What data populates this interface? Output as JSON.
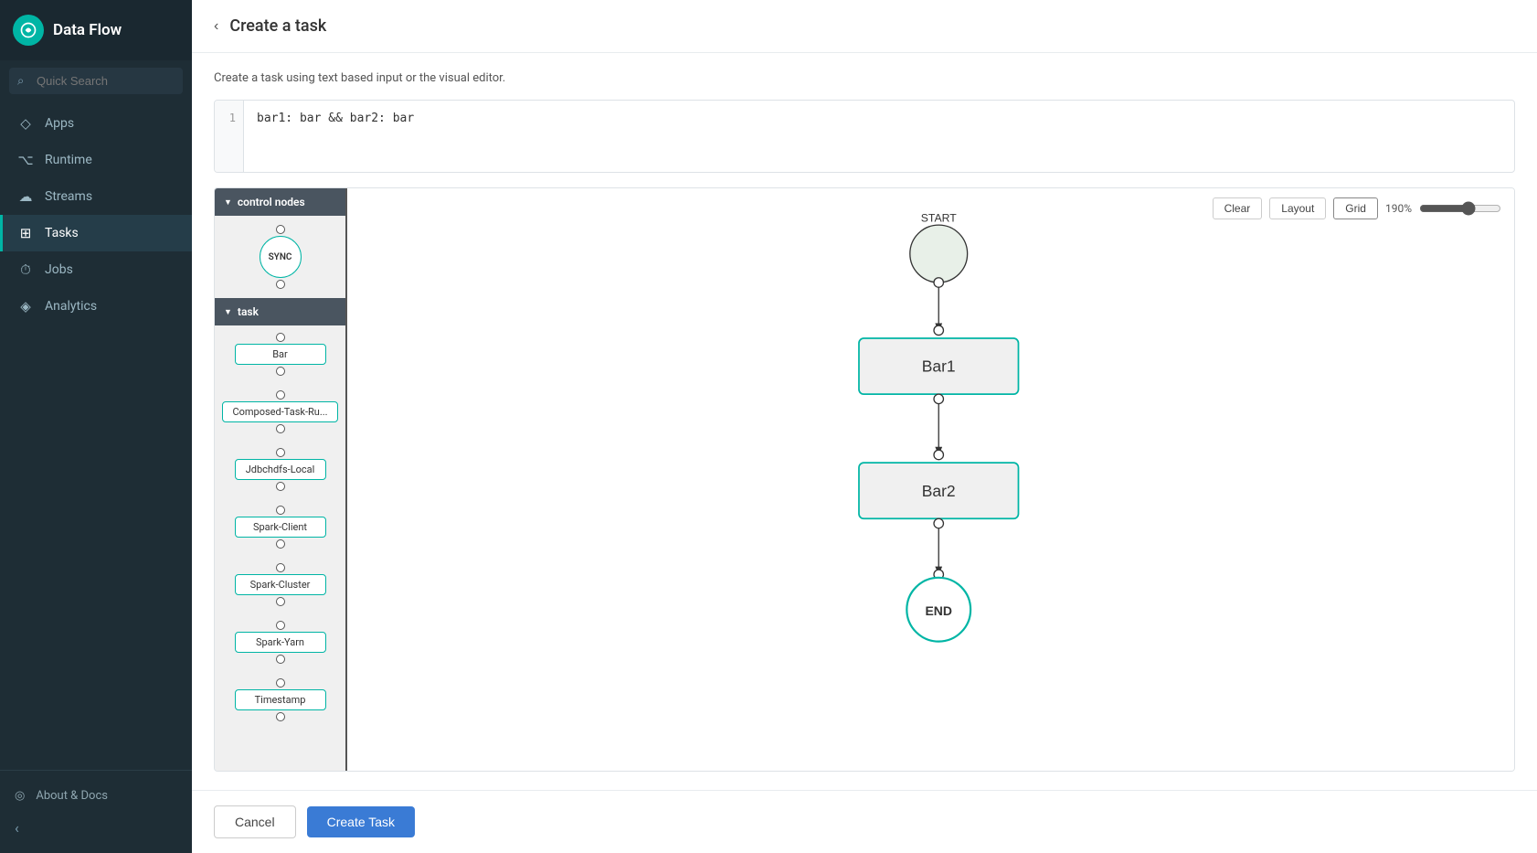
{
  "sidebar": {
    "title": "Data Flow",
    "search_placeholder": "Quick Search",
    "nav_items": [
      {
        "id": "apps",
        "label": "Apps",
        "icon": "◈"
      },
      {
        "id": "runtime",
        "label": "Runtime",
        "icon": "⌥"
      },
      {
        "id": "streams",
        "label": "Streams",
        "icon": "☁"
      },
      {
        "id": "tasks",
        "label": "Tasks",
        "icon": "⊞",
        "active": true
      },
      {
        "id": "jobs",
        "label": "Jobs",
        "icon": "⏱"
      },
      {
        "id": "analytics",
        "label": "Analytics",
        "icon": "◈"
      }
    ],
    "footer_item": "About & Docs"
  },
  "header": {
    "title": "Create a task",
    "back_label": "‹"
  },
  "subtitle": "Create a task using text based input or the visual editor.",
  "code_editor": {
    "line_number": "1",
    "code_value": "bar1: bar && bar2: bar"
  },
  "palette": {
    "sections": [
      {
        "label": "control nodes",
        "nodes": [
          {
            "type": "sync",
            "label": "SYNC"
          }
        ]
      },
      {
        "label": "task",
        "nodes": [
          {
            "label": "Bar"
          },
          {
            "label": "Composed-Task-Ru..."
          },
          {
            "label": "Jdbchdfs-Local"
          },
          {
            "label": "Spark-Client"
          },
          {
            "label": "Spark-Cluster"
          },
          {
            "label": "Spark-Yarn"
          },
          {
            "label": "Timestamp"
          }
        ]
      }
    ]
  },
  "canvas": {
    "clear_label": "Clear",
    "layout_label": "Layout",
    "grid_label": "Grid",
    "zoom_value": "190%",
    "nodes": [
      {
        "id": "start",
        "label": "START",
        "type": "start-circle"
      },
      {
        "id": "bar1",
        "label": "Bar1",
        "type": "task-box"
      },
      {
        "id": "bar2",
        "label": "Bar2",
        "type": "task-box"
      },
      {
        "id": "end",
        "label": "END",
        "type": "end-circle"
      }
    ]
  },
  "footer": {
    "cancel_label": "Cancel",
    "create_label": "Create Task"
  }
}
